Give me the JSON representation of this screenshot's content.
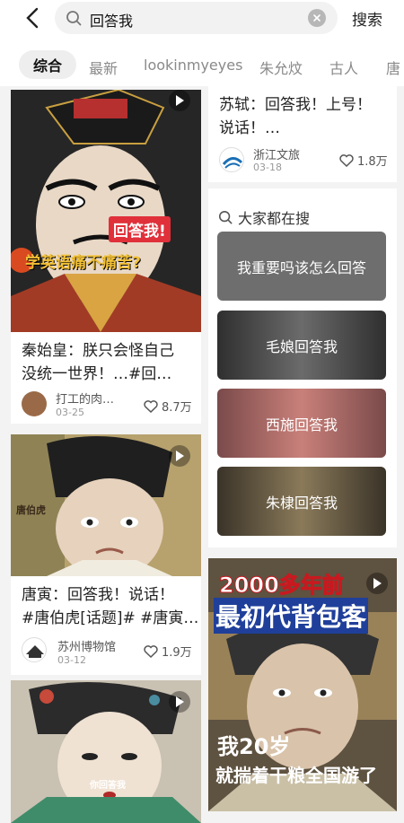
{
  "header": {
    "search_query": "回答我",
    "search_button": "搜索"
  },
  "tabs": [
    "综合",
    "最新",
    "lookinmyeyes",
    "朱允炆",
    "古人",
    "唐"
  ],
  "left_cards": [
    {
      "overlay_1": "回答我!",
      "overlay_2": "学英语痛不痛苦?",
      "title_1": "秦始皇：朕只会怪自己",
      "title_2": "没统一世界！…#回…",
      "author": "打工的肉…",
      "date": "03-25",
      "likes": "8.7万"
    },
    {
      "overlay_1": "唐伯虎",
      "title_1": "唐寅：回答我！说话！",
      "title_2": "#唐伯虎[话题]# #唐寅…",
      "author": "苏州博物馆",
      "date": "03-12",
      "likes": "1.9万"
    },
    {
      "overlay_1": "你回答我"
    }
  ],
  "right_cards": [
    {
      "title_1": "苏轼：回答我！上号！",
      "title_2": "说话！…",
      "author": "浙江文旅",
      "date": "03-18",
      "likes": "1.8万"
    }
  ],
  "trending": {
    "heading": "大家都在搜",
    "items": [
      "我重要吗该怎么回答",
      "毛娘回答我",
      "西施回答我",
      "朱棣回答我"
    ]
  },
  "bottom_right_card": {
    "overlay_1": "2000多年前",
    "overlay_2": "最初代背包客",
    "overlay_3": "我20岁",
    "overlay_4": "就揣着干粮全国游了"
  },
  "colors": {
    "accent_red": "#e0303a",
    "tab_active_bg": "#eeeeee"
  }
}
